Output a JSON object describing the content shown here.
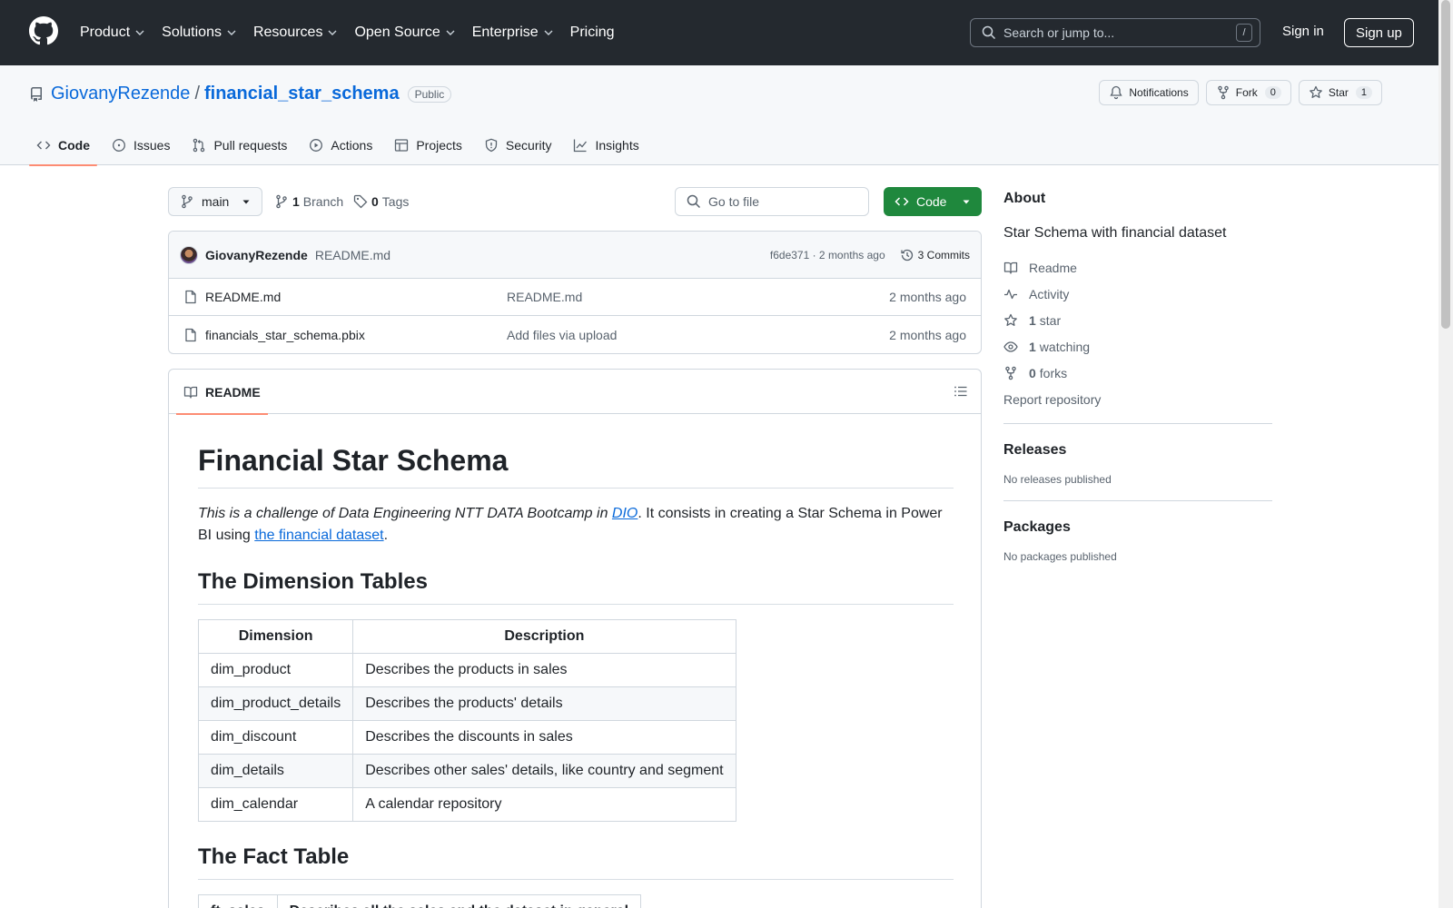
{
  "header": {
    "nav": [
      "Product",
      "Solutions",
      "Resources",
      "Open Source",
      "Enterprise",
      "Pricing"
    ],
    "search_placeholder": "Search or jump to...",
    "search_shortcut": "/",
    "signin": "Sign in",
    "signup": "Sign up"
  },
  "repo": {
    "owner": "GiovanyRezende",
    "separator": "/",
    "name": "financial_star_schema",
    "visibility": "Public",
    "actions": {
      "notifications": "Notifications",
      "fork": "Fork",
      "fork_count": "0",
      "star": "Star",
      "star_count": "1"
    },
    "tabs": [
      "Code",
      "Issues",
      "Pull requests",
      "Actions",
      "Projects",
      "Security",
      "Insights"
    ]
  },
  "toolbar": {
    "branch": "main",
    "branch_count": "1",
    "branch_label": "Branch",
    "tag_count": "0",
    "tag_label": "Tags",
    "goto_placeholder": "Go to file",
    "code_button": "Code"
  },
  "commit": {
    "author": "GiovanyRezende",
    "message": "README.md",
    "meta": "f6de371 · 2 months ago",
    "commits": "3 Commits"
  },
  "files": [
    {
      "name": "README.md",
      "message": "README.md",
      "date": "2 months ago"
    },
    {
      "name": "financials_star_schema.pbix",
      "message": "Add files via upload",
      "date": "2 months ago"
    }
  ],
  "readme": {
    "tab": "README",
    "title": "Financial Star Schema",
    "intro_em_1": "This is a challenge of Data Engineering NTT DATA Bootcamp in ",
    "intro_link_1": "DIO",
    "intro_text": ". It consists in creating a Star Schema in Power BI using ",
    "intro_link_2": "the financial dataset",
    "intro_end": ".",
    "dim_heading": "The Dimension Tables",
    "dim_table": {
      "headers": [
        "Dimension",
        "Description"
      ],
      "rows": [
        [
          "dim_product",
          "Describes the products in sales"
        ],
        [
          "dim_product_details",
          "Describes the products' details"
        ],
        [
          "dim_discount",
          "Describes the discounts in sales"
        ],
        [
          "dim_details",
          "Describes other sales' details, like country and segment"
        ],
        [
          "dim_calendar",
          "A calendar repository"
        ]
      ]
    },
    "fact_heading": "The Fact Table",
    "fact_table": {
      "headers": [
        "ft_sales",
        "Describes all the sales and the dataset in general"
      ]
    }
  },
  "sidebar": {
    "about_title": "About",
    "description": "Star Schema with financial dataset",
    "readme": "Readme",
    "activity": "Activity",
    "stars_count": "1",
    "stars_label": "star",
    "watching_count": "1",
    "watching_label": "watching",
    "forks_count": "0",
    "forks_label": "forks",
    "report": "Report repository",
    "releases_title": "Releases",
    "releases_note": "No releases published",
    "packages_title": "Packages",
    "packages_note": "No packages published"
  }
}
